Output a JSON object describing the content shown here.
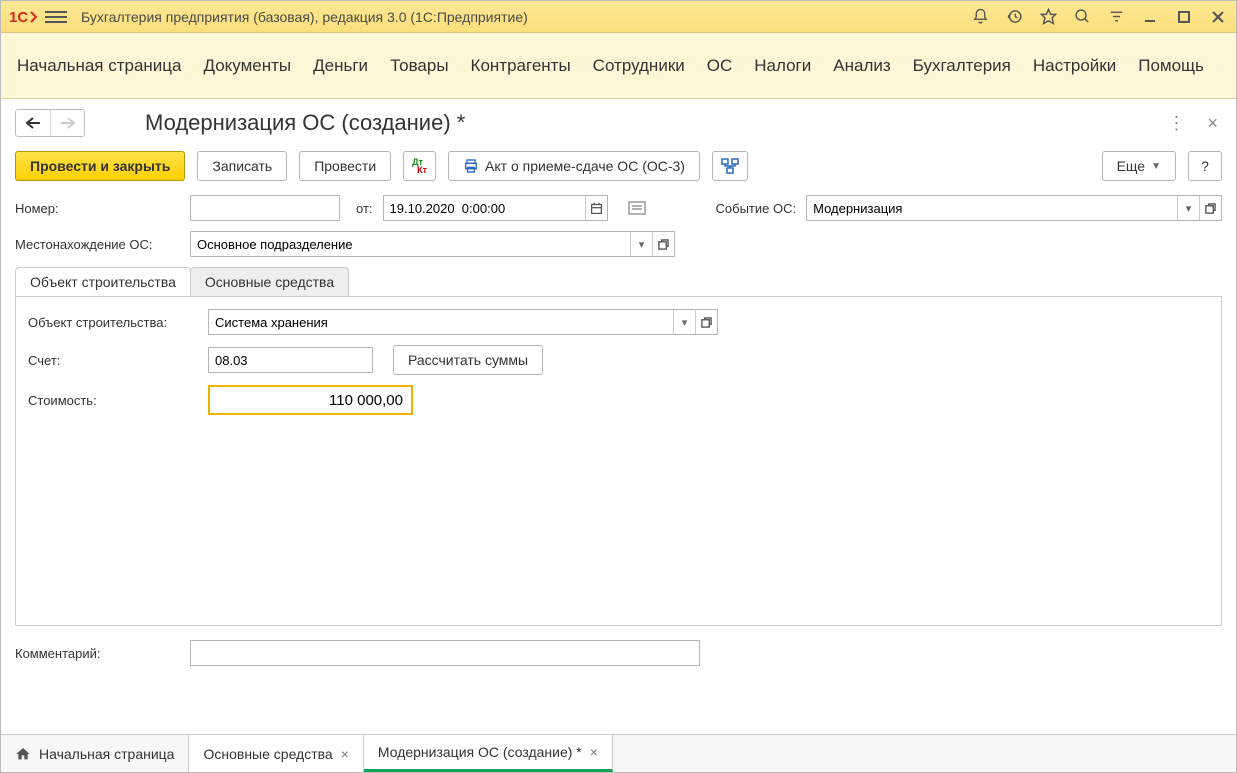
{
  "app": {
    "title": "Бухгалтерия предприятия (базовая), редакция 3.0  (1С:Предприятие)"
  },
  "menu": [
    "Начальная страница",
    "Документы",
    "Деньги",
    "Товары",
    "Контрагенты",
    "Сотрудники",
    "ОС",
    "Налоги",
    "Анализ",
    "Бухгалтерия",
    "Настройки",
    "Помощь"
  ],
  "page": {
    "title": "Модернизация ОС (создание) *"
  },
  "toolbar": {
    "post_and_close": "Провести и закрыть",
    "save": "Записать",
    "post": "Провести",
    "act": "Акт о приеме-сдаче ОС (ОС-3)",
    "more": "Еще",
    "help": "?"
  },
  "fields": {
    "number_label": "Номер:",
    "number_value": "",
    "from_label": "от:",
    "date_value": "19.10.2020  0:00:00",
    "event_label": "Событие ОС:",
    "event_value": "Модернизация",
    "location_label": "Местонахождение ОС:",
    "location_value": "Основное подразделение",
    "comment_label": "Комментарий:",
    "comment_value": ""
  },
  "tabs": {
    "construction": "Объект строительства",
    "assets": "Основные средства"
  },
  "panel": {
    "object_label": "Объект строительства:",
    "object_value": "Система хранения",
    "account_label": "Счет:",
    "account_value": "08.03",
    "calc_button": "Рассчитать суммы",
    "cost_label": "Стоимость:",
    "cost_value": "110 000,00"
  },
  "bottom_tabs": {
    "home": "Начальная страница",
    "assets": "Основные средства",
    "current": "Модернизация ОС (создание) *"
  }
}
